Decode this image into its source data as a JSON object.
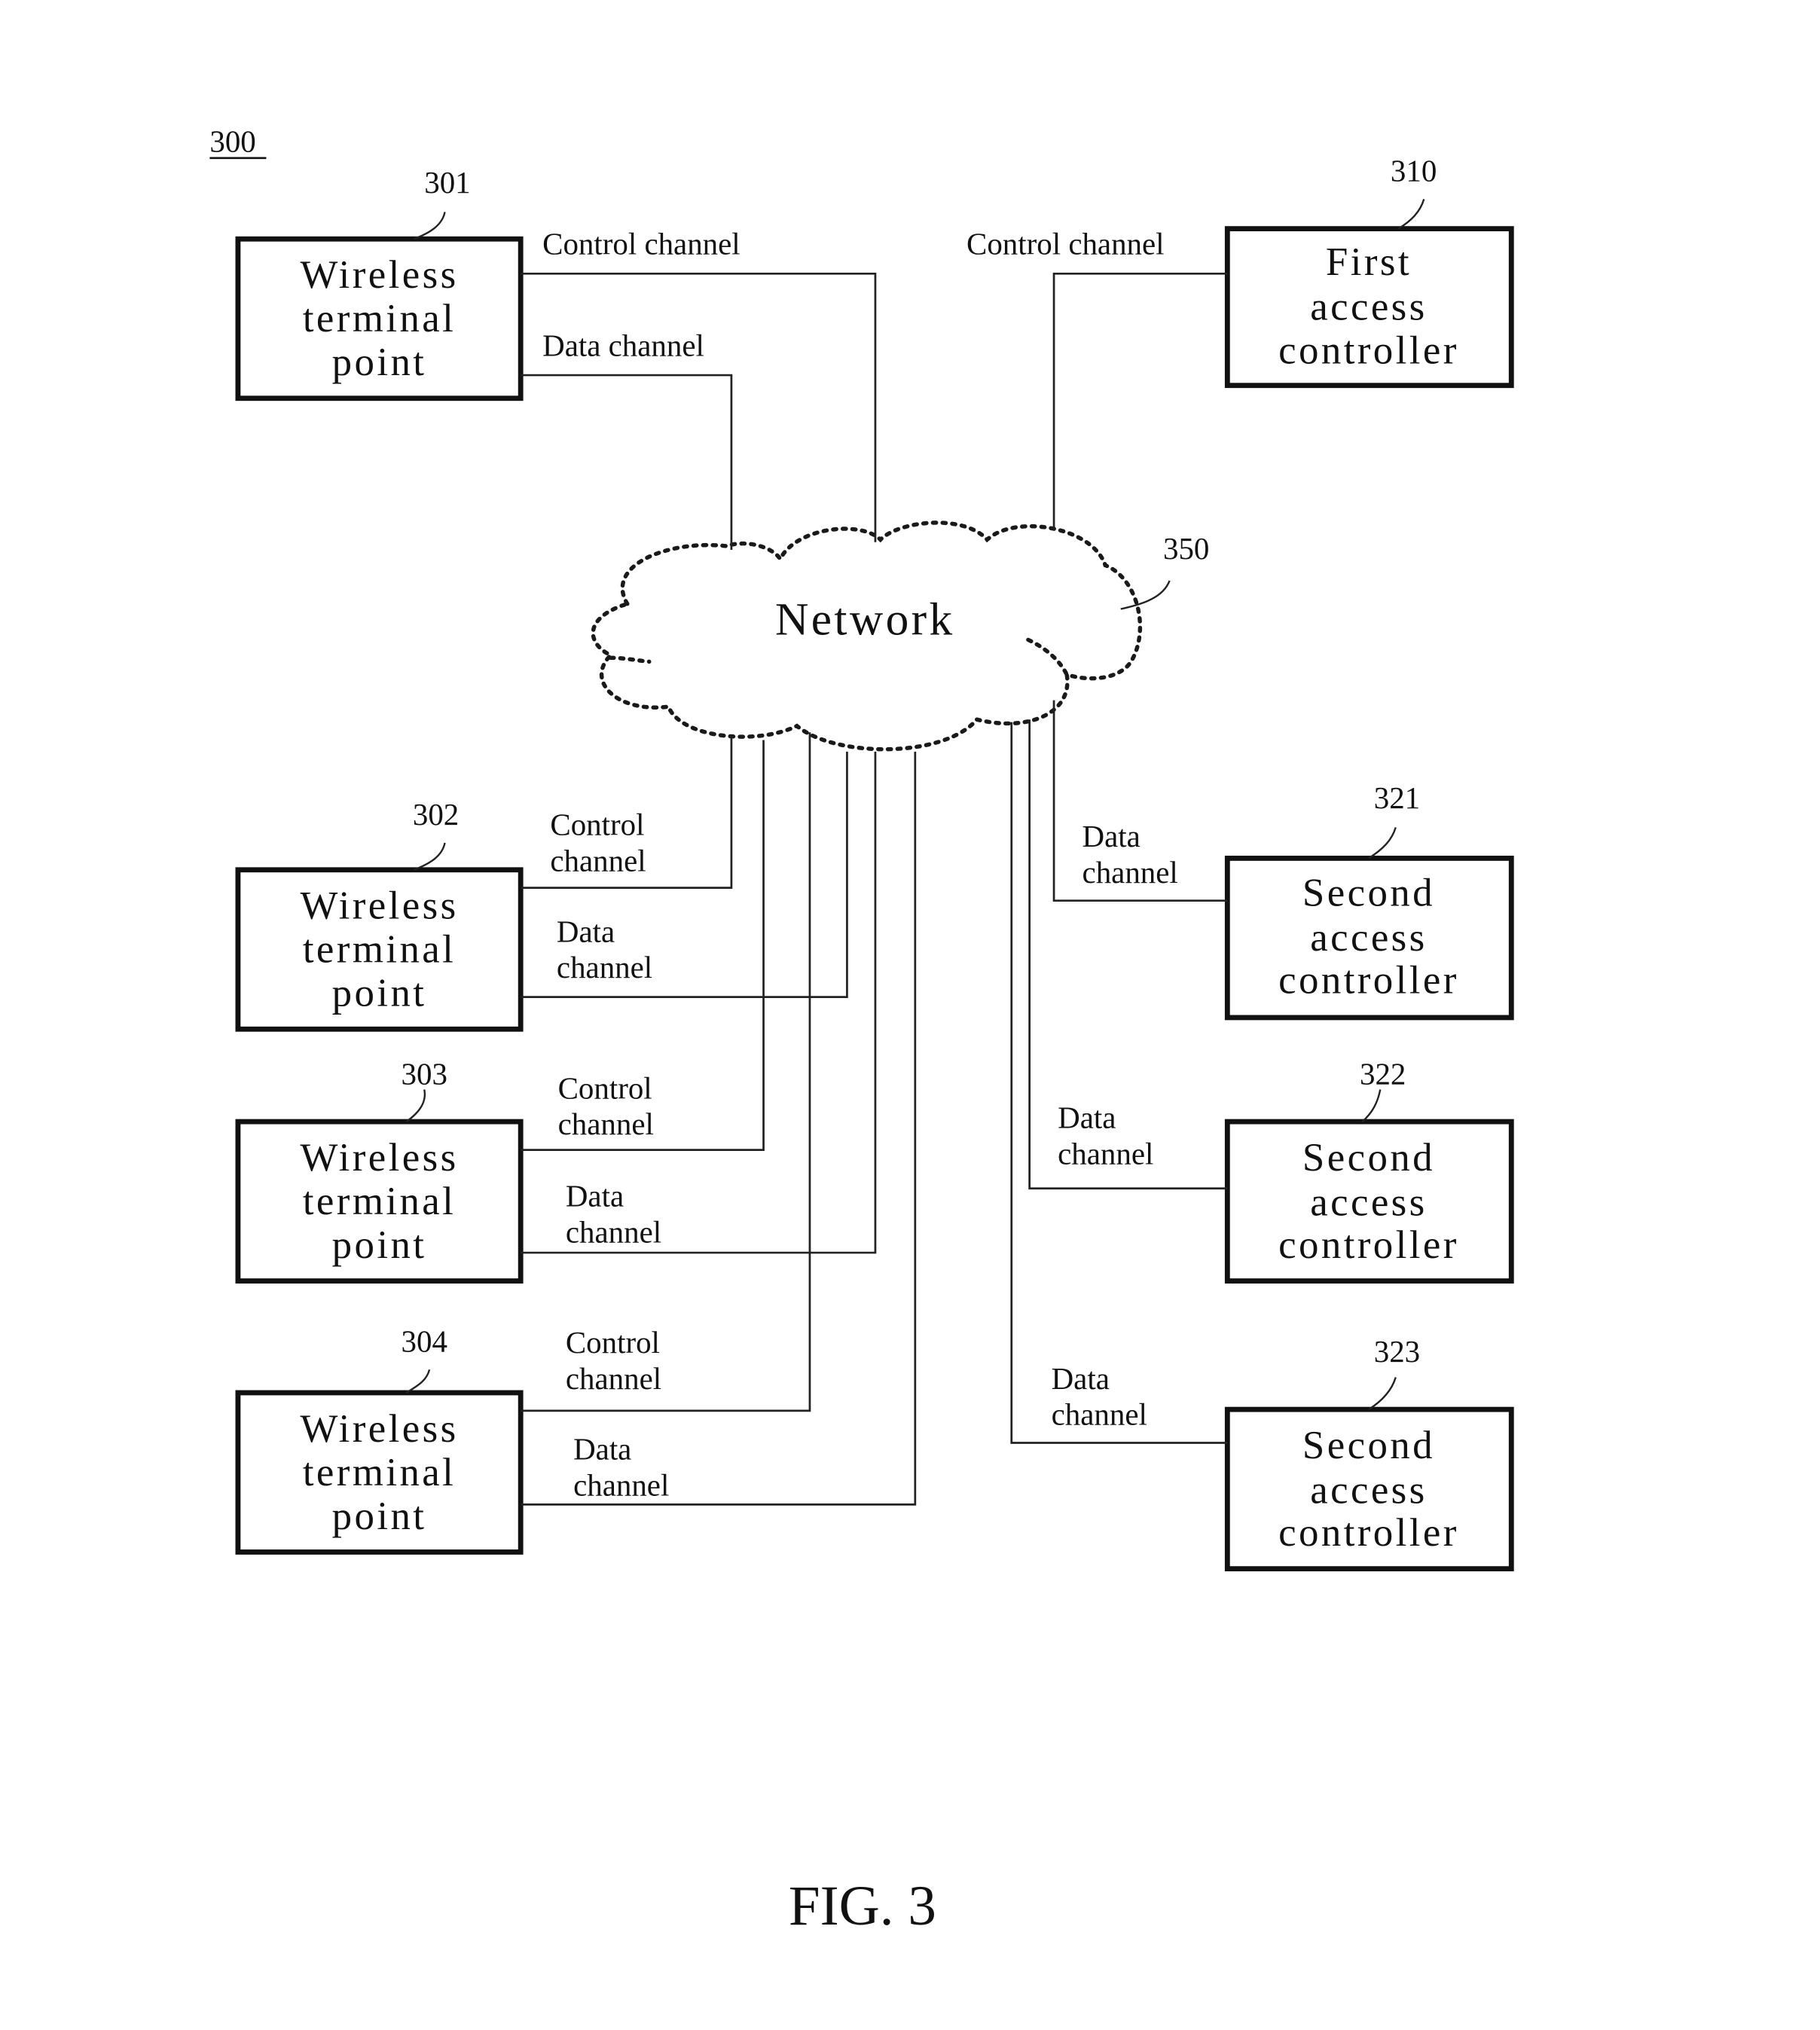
{
  "figure": {
    "ref_number": "300",
    "caption": "FIG. 3"
  },
  "network": {
    "ref": "350",
    "label": "Network"
  },
  "wireless_terminals": [
    {
      "ref": "301",
      "lines": [
        "Wireless",
        "terminal",
        "point"
      ],
      "control_label": [
        "Control channel"
      ],
      "data_label": [
        "Data channel"
      ]
    },
    {
      "ref": "302",
      "lines": [
        "Wireless",
        "terminal",
        "point"
      ],
      "control_label": [
        "Control",
        "channel"
      ],
      "data_label": [
        "Data",
        "channel"
      ]
    },
    {
      "ref": "303",
      "lines": [
        "Wireless",
        "terminal",
        "point"
      ],
      "control_label": [
        "Control",
        "channel"
      ],
      "data_label": [
        "Data",
        "channel"
      ]
    },
    {
      "ref": "304",
      "lines": [
        "Wireless",
        "terminal",
        "point"
      ],
      "control_label": [
        "Control",
        "channel"
      ],
      "data_label": [
        "Data",
        "channel"
      ]
    }
  ],
  "first_access_controller": {
    "ref": "310",
    "lines": [
      "First",
      "access",
      "controller"
    ],
    "control_label": [
      "Control channel"
    ]
  },
  "second_access_controllers": [
    {
      "ref": "321",
      "lines": [
        "Second",
        "access",
        "controller"
      ],
      "data_label": [
        "Data",
        "channel"
      ]
    },
    {
      "ref": "322",
      "lines": [
        "Second",
        "access",
        "controller"
      ],
      "data_label": [
        "Data",
        "channel"
      ]
    },
    {
      "ref": "323",
      "lines": [
        "Second",
        "access",
        "controller"
      ],
      "data_label": [
        "Data",
        "channel"
      ]
    }
  ]
}
